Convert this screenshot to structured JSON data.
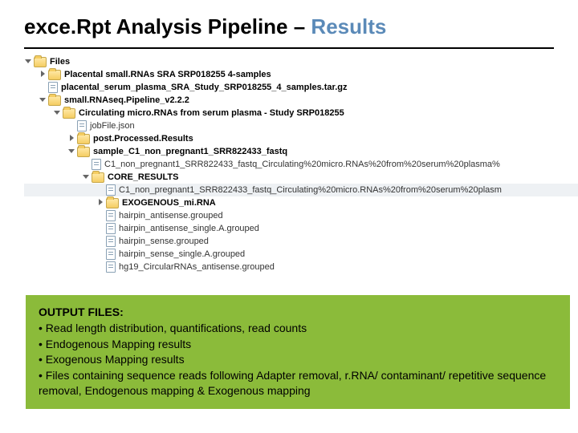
{
  "title": {
    "pre": "exce.Rpt Analysis Pipeline ",
    "dash": "– ",
    "accent": "Results"
  },
  "tree": [
    {
      "indent": 0,
      "tw": "open",
      "icon": "folder",
      "bold": true,
      "label": "Files"
    },
    {
      "indent": 1,
      "tw": "closed",
      "icon": "folder",
      "bold": true,
      "label": "Placental small.RNAs SRA SRP018255 4-samples"
    },
    {
      "indent": 1,
      "tw": "none",
      "icon": "file",
      "bold": true,
      "label": "placental_serum_plasma_SRA_Study_SRP018255_4_samples.tar.gz"
    },
    {
      "indent": 1,
      "tw": "open",
      "icon": "folder",
      "bold": true,
      "label": "small.RNAseq.Pipeline_v2.2.2"
    },
    {
      "indent": 2,
      "tw": "open",
      "icon": "folder",
      "bold": true,
      "label": "Circulating micro.RNAs from serum plasma - Study SRP018255"
    },
    {
      "indent": 3,
      "tw": "none",
      "icon": "file",
      "bold": false,
      "label": "jobFile.json"
    },
    {
      "indent": 3,
      "tw": "closed",
      "icon": "folder",
      "bold": true,
      "label": "post.Processed.Results"
    },
    {
      "indent": 3,
      "tw": "open",
      "icon": "folder",
      "bold": true,
      "label": "sample_C1_non_pregnant1_SRR822433_fastq"
    },
    {
      "indent": 4,
      "tw": "none",
      "icon": "file",
      "bold": false,
      "label": "C1_non_pregnant1_SRR822433_fastq_Circulating%20micro.RNAs%20from%20serum%20plasma%"
    },
    {
      "indent": 4,
      "tw": "open",
      "icon": "folder",
      "bold": true,
      "label": "CORE_RESULTS"
    },
    {
      "indent": 5,
      "tw": "none",
      "icon": "file",
      "bold": false,
      "sel": true,
      "label": "C1_non_pregnant1_SRR822433_fastq_Circulating%20micro.RNAs%20from%20serum%20plasm"
    },
    {
      "indent": 5,
      "tw": "closed",
      "icon": "folder",
      "bold": true,
      "label": "EXOGENOUS_mi.RNA"
    },
    {
      "indent": 5,
      "tw": "none",
      "icon": "file",
      "bold": false,
      "label": "hairpin_antisense.grouped"
    },
    {
      "indent": 5,
      "tw": "none",
      "icon": "file",
      "bold": false,
      "label": "hairpin_antisense_single.A.grouped"
    },
    {
      "indent": 5,
      "tw": "none",
      "icon": "file",
      "bold": false,
      "label": "hairpin_sense.grouped"
    },
    {
      "indent": 5,
      "tw": "none",
      "icon": "file",
      "bold": false,
      "label": "hairpin_sense_single.A.grouped"
    },
    {
      "indent": 5,
      "tw": "none",
      "icon": "file",
      "bold": false,
      "label": "hg19_CircularRNAs_antisense.grouped"
    }
  ],
  "callout": {
    "heading": "OUTPUT FILES:",
    "lines": [
      "• Read length distribution, quantifications, read counts",
      "• Endogenous Mapping results",
      "• Exogenous Mapping results",
      "• Files containing sequence reads following Adapter removal, r.RNA/ contaminant/ repetitive sequence removal, Endogenous mapping & Exogenous mapping"
    ]
  }
}
